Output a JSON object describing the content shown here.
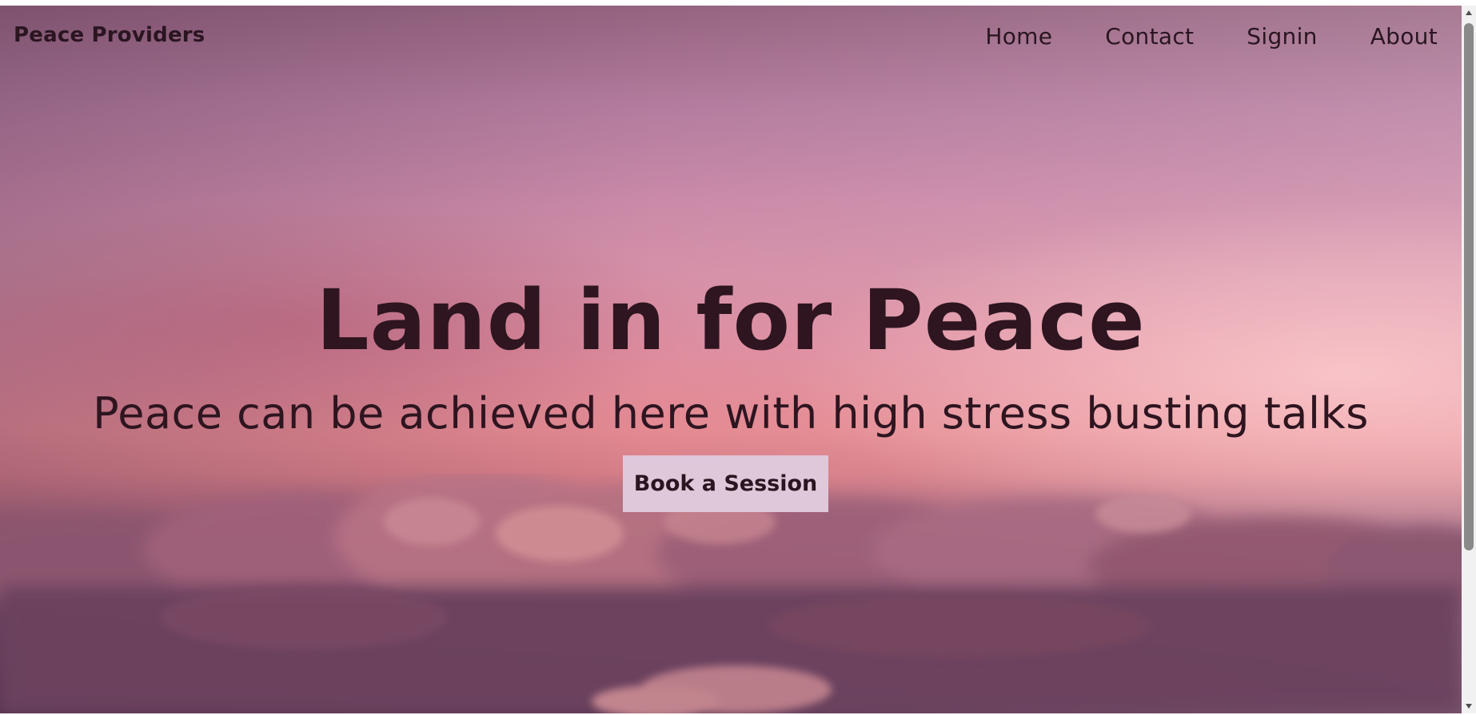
{
  "navbar": {
    "brand": "Peace Providers",
    "links": [
      {
        "label": "Home"
      },
      {
        "label": "Contact"
      },
      {
        "label": "Signin"
      },
      {
        "label": "About"
      }
    ]
  },
  "hero": {
    "title": "Land in for Peace",
    "subtitle": "Peace can be achieved here with high stress busting talks",
    "cta_label": "Book a Session",
    "background_image": "pink-sunset-sky-above-clouds"
  },
  "colors": {
    "text": "#2e1520",
    "button_bg": "#dfc8d9",
    "sky_top": "#94637f",
    "sky_mid": "#df8d9e",
    "sky_horizon": "#e48a92",
    "clouds": "#7c4c68"
  },
  "icons": {
    "scroll_up": "scroll-up-arrow-icon",
    "scroll_down": "scroll-down-arrow-icon"
  }
}
